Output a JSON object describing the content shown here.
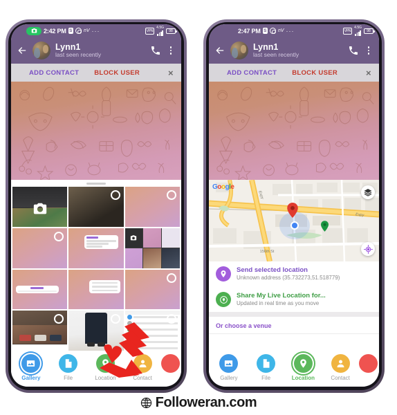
{
  "footer": {
    "brand": "Followeran.com",
    "icon": "globe-icon"
  },
  "colors": {
    "header_purple": "#6e5b86",
    "accent_purple": "#7a4fc4",
    "danger_red": "#c43b2e",
    "green": "#4caf50",
    "blue": "#3f9ae8",
    "orange": "#f0b440"
  },
  "phones": [
    {
      "id": "left",
      "status_bar": {
        "camera_pill_icon": "camera-icon",
        "time": "2:42 PM",
        "icons": [
          "S",
          "whatsapp-icon",
          "nV",
          "overflow-dots"
        ],
        "right_icons": {
          "vpn": "VPN",
          "network": "4.5G",
          "battery": "98"
        }
      },
      "chat_header": {
        "back_icon": "back-arrow-icon",
        "avatar": "contact-avatar",
        "title": "Lynn1",
        "subtitle": "last seen recently",
        "call_icon": "phone-icon",
        "menu_icon": "kebab-menu-icon"
      },
      "action_bar": {
        "add": "ADD CONTACT",
        "block": "BLOCK USER",
        "close": "×"
      },
      "attachment_sheet": {
        "active_tab": "Gallery"
      },
      "nav": [
        {
          "label": "Gallery",
          "icon": "image-icon",
          "color": "#3f9ae8",
          "selected": true
        },
        {
          "label": "File",
          "icon": "file-icon",
          "color": "#3fb6e8",
          "selected": false
        },
        {
          "label": "Location",
          "icon": "pin-icon",
          "color": "#5cb85c",
          "selected": false
        },
        {
          "label": "Contact",
          "icon": "person-icon",
          "color": "#f0b440",
          "selected": false
        }
      ],
      "annotation": "red-arrow-pointing-to-location"
    },
    {
      "id": "right",
      "status_bar": {
        "camera_pill_icon": null,
        "time": "2:47 PM",
        "icons": [
          "S",
          "whatsapp-icon",
          "nV",
          "overflow-dots"
        ],
        "right_icons": {
          "vpn": "VPN",
          "network": "4.5G",
          "battery": "98"
        }
      },
      "chat_header": {
        "back_icon": "back-arrow-icon",
        "avatar": "contact-avatar",
        "title": "Lynn1",
        "subtitle": "last seen recently",
        "call_icon": "phone-icon",
        "menu_icon": "kebab-menu-icon"
      },
      "action_bar": {
        "add": "ADD CONTACT",
        "block": "BLOCK USER",
        "close": "×"
      },
      "map": {
        "provider_logo": "Google",
        "road_labels": [
          "Expy",
          "Expy",
          "156th St"
        ],
        "markers": [
          "red-pin",
          "blue-location-dot",
          "green-pin"
        ],
        "layers_button_icon": "layers-icon",
        "locate_button_icon": "my-location-icon"
      },
      "location_options": [
        {
          "icon": "pin-icon",
          "title": "Send selected location",
          "subtitle": "Unknown address (35.732273,51.518779)"
        },
        {
          "icon": "live-location-icon",
          "title": "Share My Live Location for...",
          "subtitle": "Updated in real time as you move"
        }
      ],
      "venue_header": "Or choose a venue",
      "nav": [
        {
          "label": "Gallery",
          "icon": "image-icon",
          "color": "#3f9ae8",
          "selected": false
        },
        {
          "label": "File",
          "icon": "file-icon",
          "color": "#3fb6e8",
          "selected": false
        },
        {
          "label": "Location",
          "icon": "pin-icon",
          "color": "#5cb85c",
          "selected": true
        },
        {
          "label": "Contact",
          "icon": "person-icon",
          "color": "#f0b440",
          "selected": false
        }
      ]
    }
  ]
}
